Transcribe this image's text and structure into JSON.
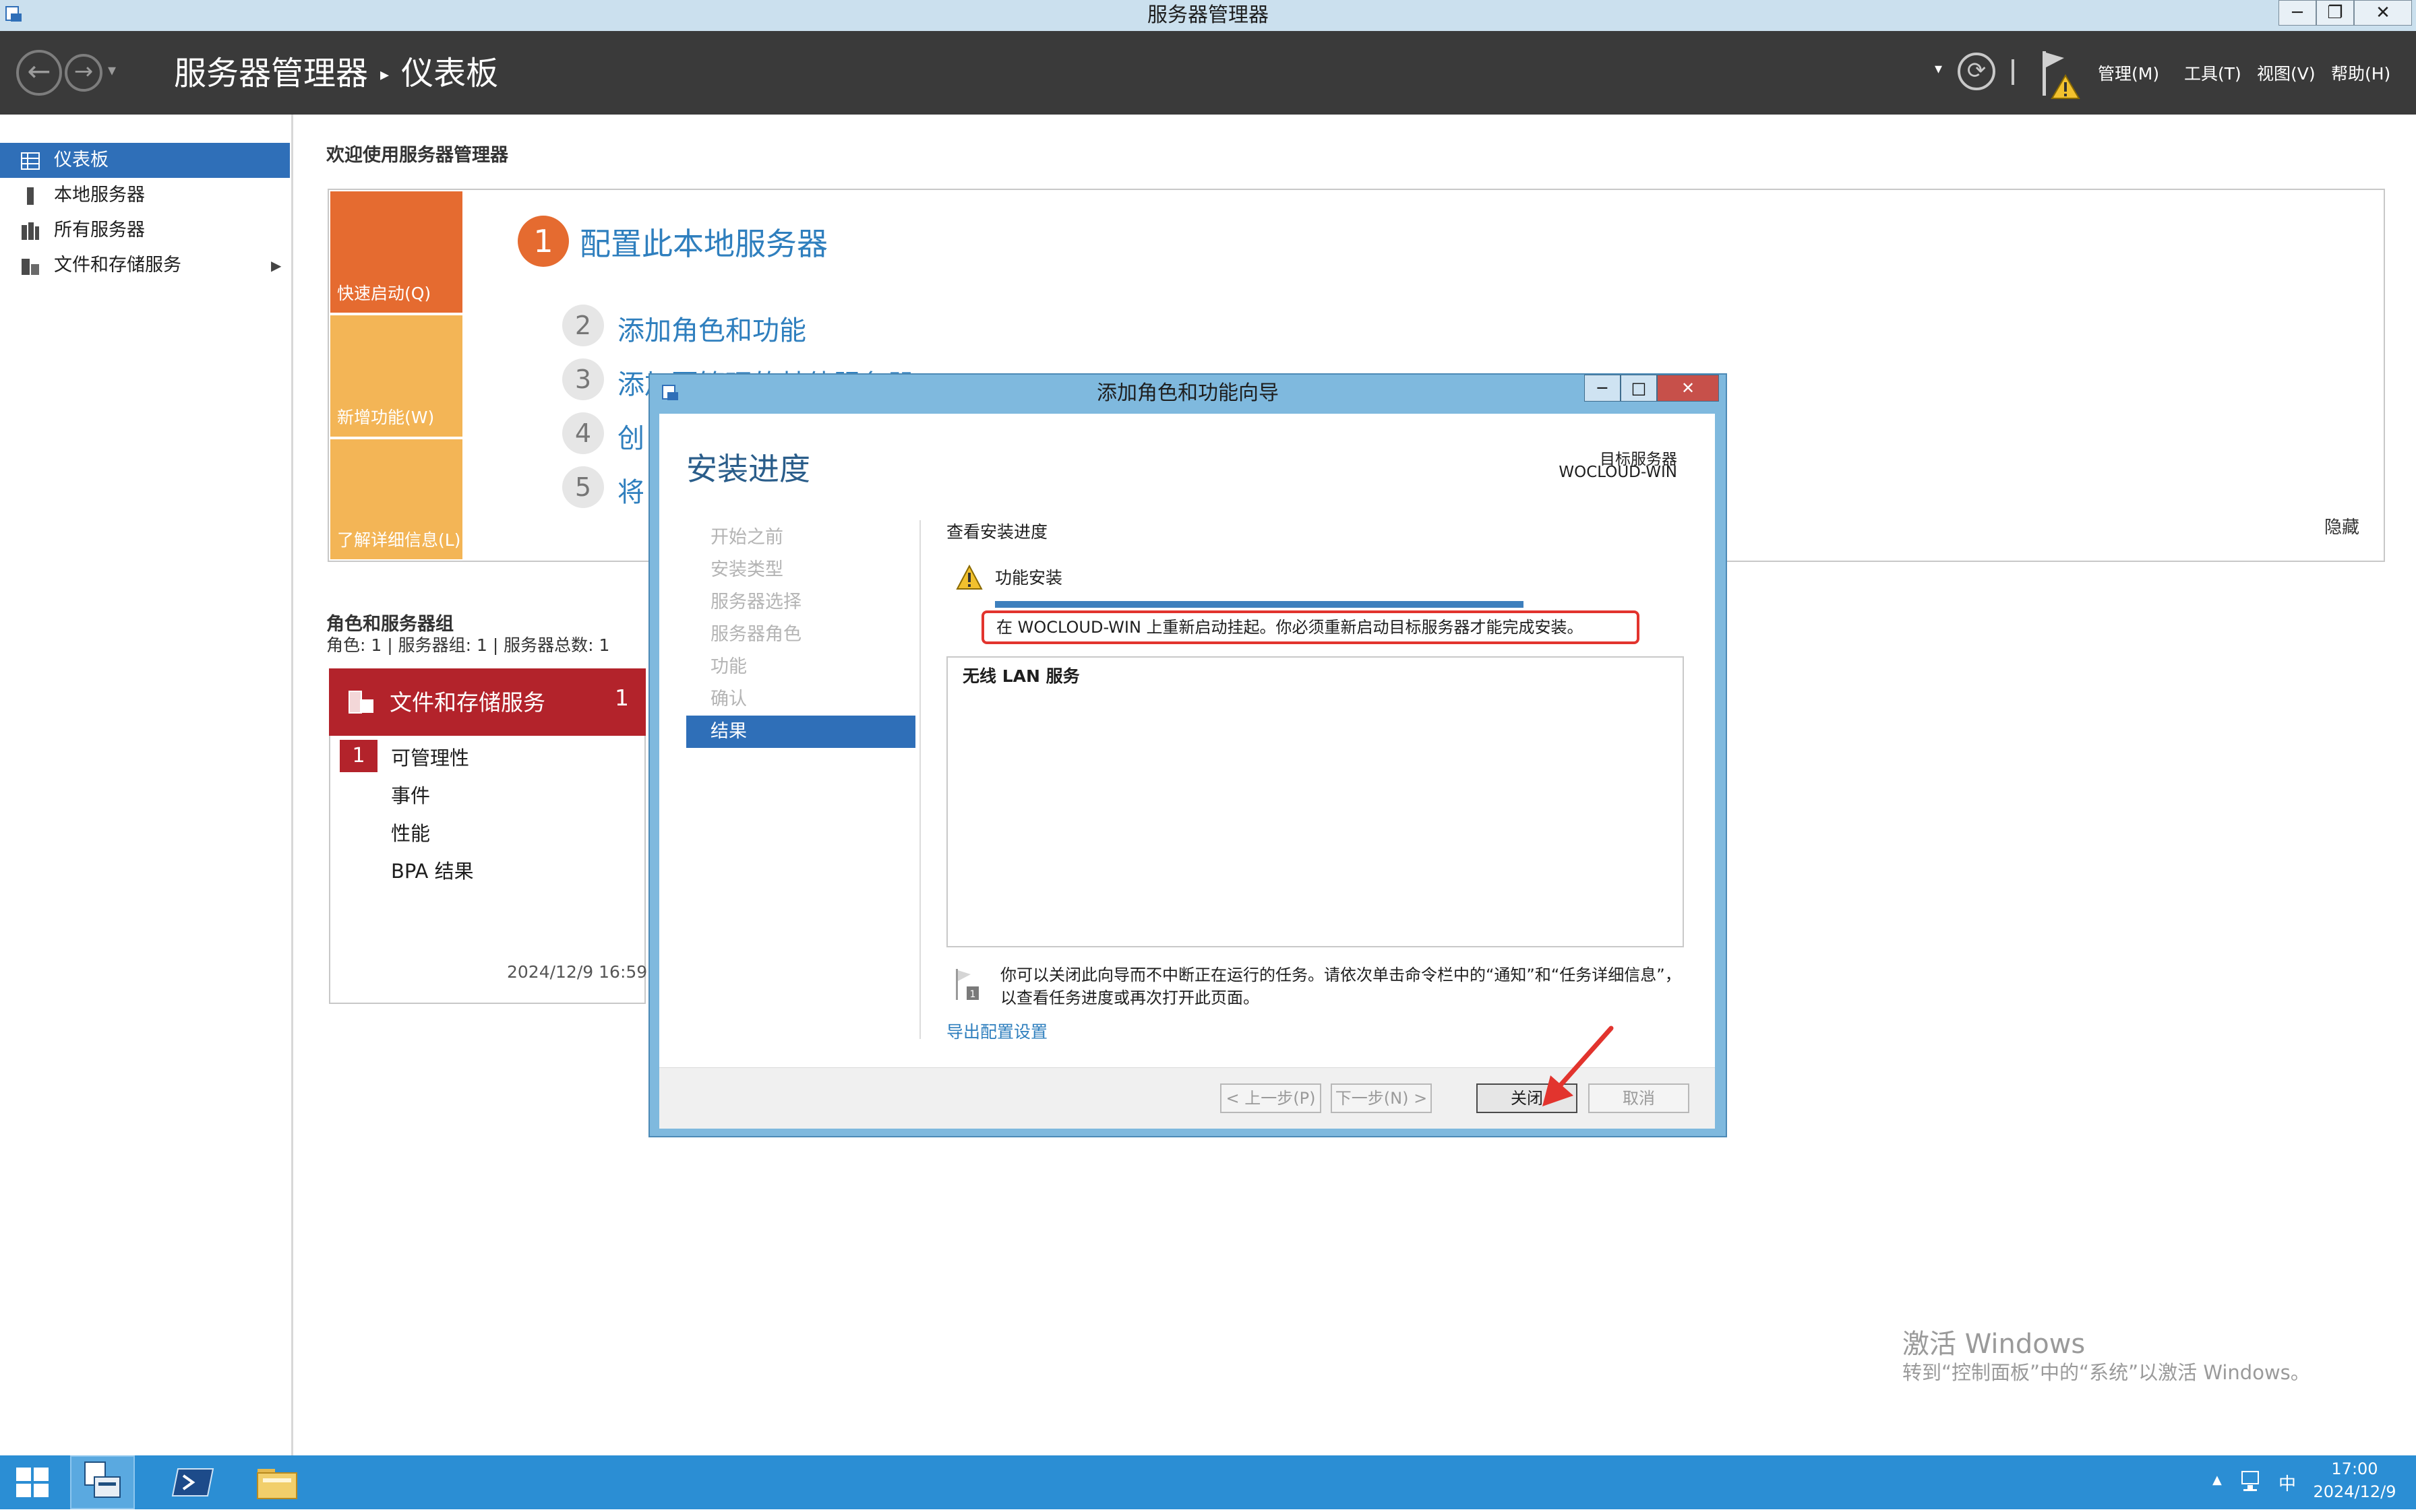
{
  "os_window": {
    "title": "服务器管理器",
    "minimize_glyph": "─",
    "restore_glyph": "❐",
    "close_glyph": "✕"
  },
  "header": {
    "app_name": "服务器管理器",
    "separator": "▸",
    "page_name": "仪表板",
    "back_glyph": "←",
    "forward_glyph": "→",
    "dropdown_glyph": "▾",
    "refresh_glyph": "⟳",
    "menus": [
      "管理(M)",
      "工具(T)",
      "视图(V)",
      "帮助(H)"
    ]
  },
  "sidebar": {
    "items": [
      {
        "label": "仪表板",
        "icon": "dashboard-icon",
        "active": true
      },
      {
        "label": "本地服务器",
        "icon": "server-icon"
      },
      {
        "label": "所有服务器",
        "icon": "servers-icon"
      },
      {
        "label": "文件和存储服务",
        "icon": "storage-icon",
        "expandable": true
      }
    ],
    "expand_glyph": "▶"
  },
  "main": {
    "welcome": "欢迎使用服务器管理器",
    "quick_start": {
      "tabs": [
        "快速启动(Q)",
        "新增功能(W)",
        "了解详细信息(L)"
      ],
      "steps": [
        {
          "num": "1",
          "text": "配置此本地服务器"
        },
        {
          "num": "2",
          "text": "添加角色和功能"
        },
        {
          "num": "3",
          "text": "添加要管理的其他服务器"
        },
        {
          "num": "4",
          "text": "创"
        },
        {
          "num": "5",
          "text": "将"
        }
      ],
      "hide_label": "隐藏"
    },
    "roles": {
      "title": "角色和服务器组",
      "summary": "角色: 1 | 服务器组: 1 | 服务器总数: 1",
      "tile": {
        "name": "文件和存储服务",
        "count": "1",
        "rows": [
          {
            "badge": "1",
            "label": "可管理性"
          },
          {
            "label": "事件"
          },
          {
            "label": "性能"
          },
          {
            "label": "BPA 结果"
          }
        ],
        "timestamp": "2024/12/9 16:59"
      }
    }
  },
  "watermark": {
    "title": "激活 Windows",
    "subtitle": "转到“控制面板”中的“系统”以激活 Windows。"
  },
  "dialog": {
    "title": "添加角色和功能向导",
    "heading": "安装进度",
    "target_label": "目标服务器",
    "target_value": "WOCLOUD-WIN",
    "steps": [
      {
        "label": "开始之前"
      },
      {
        "label": "安装类型"
      },
      {
        "label": "服务器选择"
      },
      {
        "label": "服务器角色"
      },
      {
        "label": "功能"
      },
      {
        "label": "确认"
      },
      {
        "label": "结果",
        "active": true
      }
    ],
    "section_label": "查看安装进度",
    "feature_label": "功能安装",
    "progress_fraction": 1.0,
    "status_message": "在 WOCLOUD-WIN 上重新启动挂起。你必须重新启动目标服务器才能完成安装。",
    "results_item": "无线 LAN 服务",
    "info_text": "你可以关闭此向导而不中断正在运行的任务。请依次单击命令栏中的“通知”和“任务详细信息”，以查看任务进度或再次打开此页面。",
    "export_link": "导出配置设置",
    "buttons": {
      "prev": "< 上一步(P)",
      "next": "下一步(N) >",
      "close": "关闭",
      "cancel": "取消"
    },
    "win_min": "─",
    "win_max": "□",
    "win_close": "✕"
  },
  "taskbar": {
    "tray_up_glyph": "▲",
    "ime": "中",
    "time": "17:00",
    "date": "2024/12/9"
  },
  "colors": {
    "accent_blue": "#2f6fb8",
    "quick_start_orange": "#e56b30",
    "tile_red": "#b3232b",
    "highlight_red": "#e2342e",
    "taskbar_blue": "#2b8ed4"
  }
}
